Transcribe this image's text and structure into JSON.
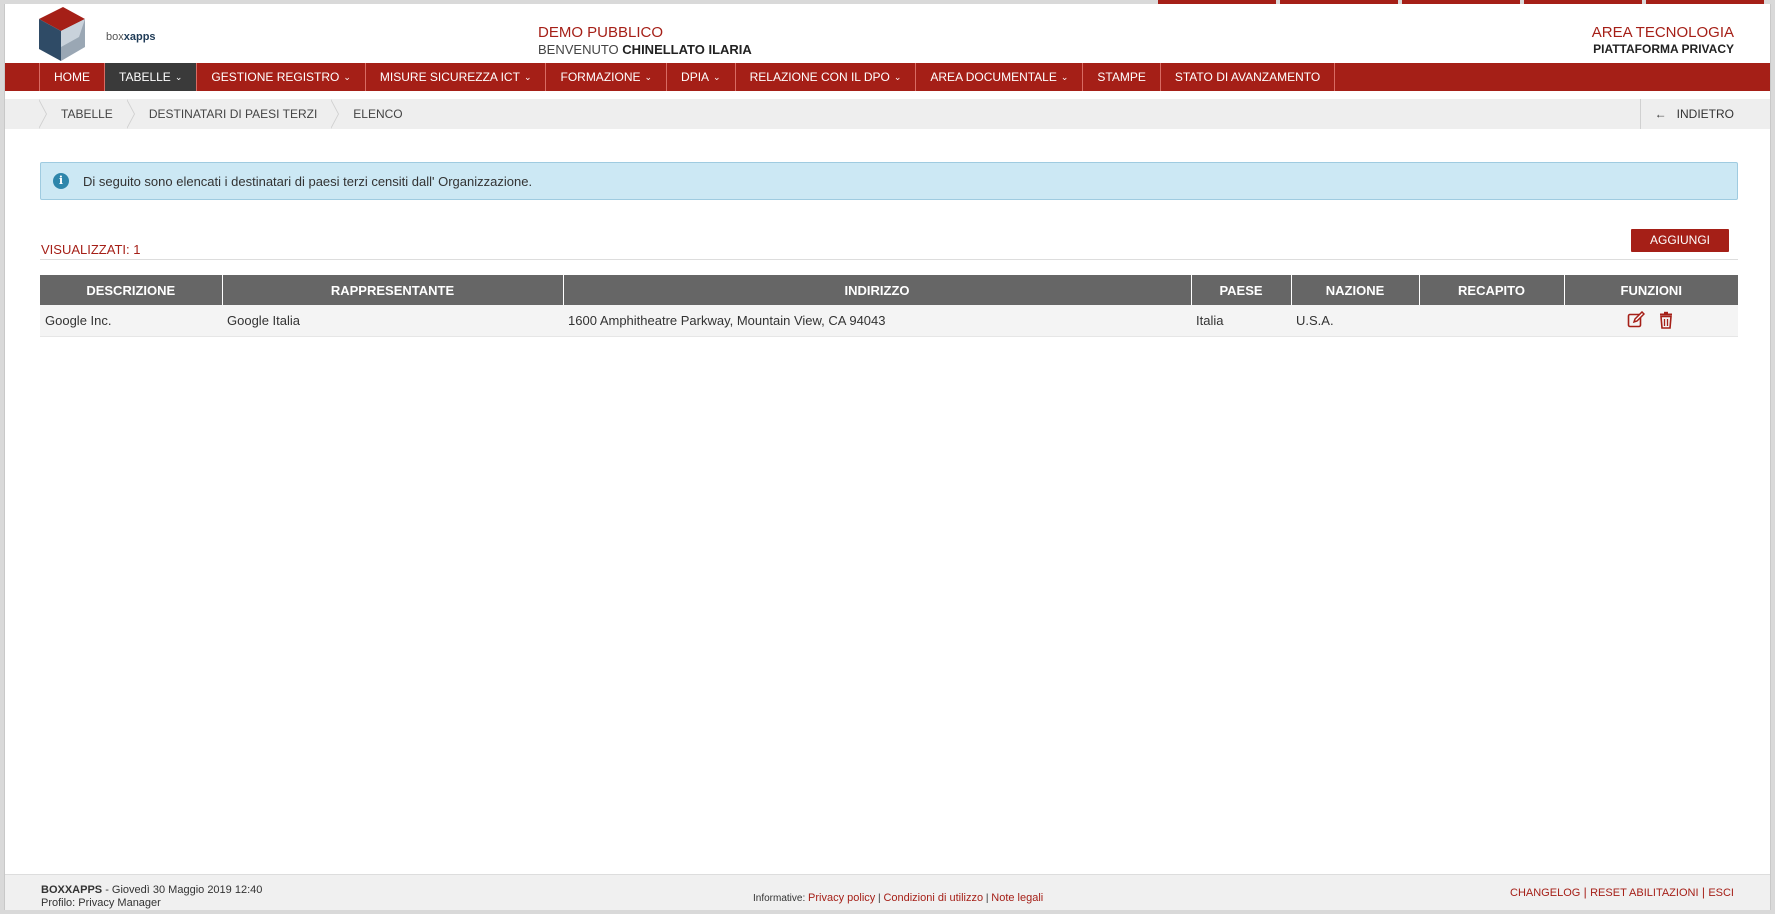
{
  "header": {
    "logo_brand_1": "box",
    "logo_brand_2": "xapps",
    "demo": "DEMO PUBBLICO",
    "welcome_prefix": "BENVENUTO",
    "user": "CHINELLATO ILARIA",
    "area": "AREA TECNOLOGIA",
    "platform": "PIATTAFORMA PRIVACY"
  },
  "nav": [
    {
      "label": "HOME",
      "dropdown": false
    },
    {
      "label": "TABELLE",
      "dropdown": true
    },
    {
      "label": "GESTIONE REGISTRO",
      "dropdown": true
    },
    {
      "label": "MISURE SICUREZZA ICT",
      "dropdown": true
    },
    {
      "label": "FORMAZIONE",
      "dropdown": true
    },
    {
      "label": "DPIA",
      "dropdown": true
    },
    {
      "label": "RELAZIONE CON IL DPO",
      "dropdown": true
    },
    {
      "label": "AREA DOCUMENTALE",
      "dropdown": true
    },
    {
      "label": "STAMPE",
      "dropdown": false
    },
    {
      "label": "STATO DI AVANZAMENTO",
      "dropdown": false
    }
  ],
  "breadcrumb": [
    "TABELLE",
    "DESTINATARI DI PAESI TERZI",
    "ELENCO"
  ],
  "back_label": "INDIETRO",
  "info_text": "Di seguito sono elencati i destinatari di paesi terzi censiti dall' Organizzazione.",
  "count_label": "VISUALIZZATI: 1",
  "add_label": "AGGIUNGI",
  "table": {
    "columns": [
      "DESCRIZIONE",
      "RAPPRESENTANTE",
      "INDIRIZZO",
      "PAESE",
      "NAZIONE",
      "RECAPITO",
      "FUNZIONI"
    ],
    "rows": [
      [
        "Google Inc.",
        "Google Italia",
        "1600 Amphitheatre Parkway, Mountain View, CA 94043",
        "Italia",
        "U.S.A.",
        ""
      ]
    ]
  },
  "footer": {
    "brand": "BOXXAPPS",
    "date": "- Giovedì 30 Maggio 2019 12:40",
    "profile": "Profilo: Privacy Manager",
    "informative": "Informative:",
    "privacy": "Privacy policy",
    "conditions": "Condizioni di utilizzo",
    "legal": "Note legali",
    "changelog": "CHANGELOG",
    "reset": "RESET ABILITAZIONI",
    "exit": "ESCI"
  },
  "colors": {
    "brand_red": "#a51f17",
    "info_bg": "#cce8f4",
    "table_header": "#666666"
  }
}
